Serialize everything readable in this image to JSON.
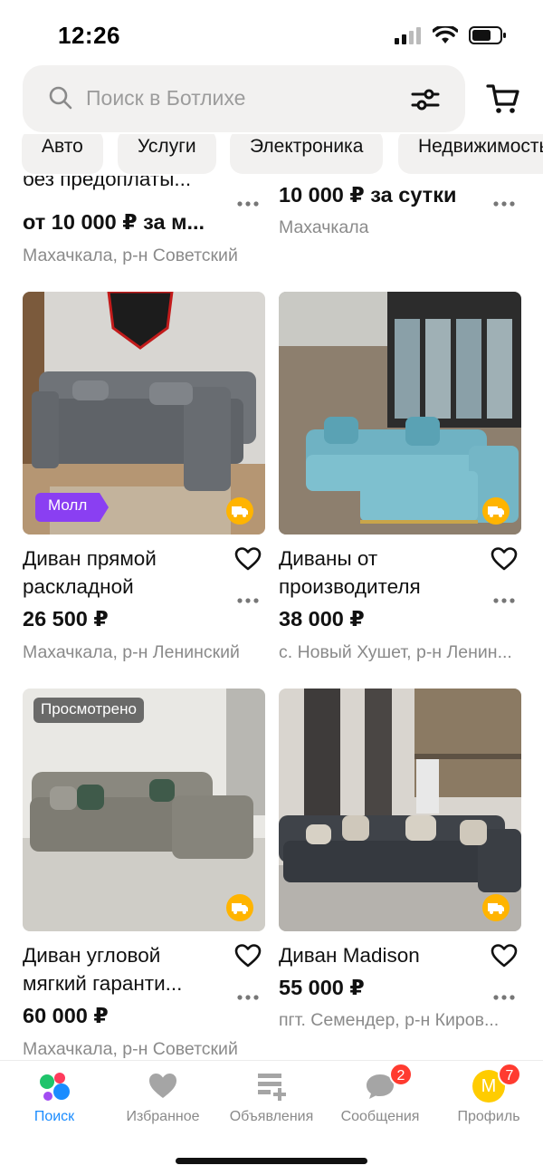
{
  "status": {
    "time": "12:26"
  },
  "search": {
    "placeholder": "Поиск в Ботлихе"
  },
  "categories": [
    "Авто",
    "Услуги",
    "Электроника",
    "Недвижимость"
  ],
  "partial_cards": [
    {
      "title_tail": "без предоплаты...",
      "price": "от 10 000 ₽ за м...",
      "location": "Махачкала, р-н Советский"
    },
    {
      "price": "10 000 ₽ за сутки",
      "location": "Махачкала"
    }
  ],
  "cards": [
    {
      "title": "Диван прямой раскладной",
      "price": "26 500 ₽",
      "location": "Махачкала, р-н Ленинский",
      "badge": "Молл",
      "favorite": false,
      "photo_color": "#7a7f85"
    },
    {
      "title": "Диваны от производителя",
      "price": "38 000 ₽",
      "location": "с. Новый Хушет, р-н Ленин...",
      "badge": "",
      "favorite": false,
      "photo_color": "#7fb8c6"
    },
    {
      "title": "Диван угловой мягкий гаранти...",
      "price": "60 000 ₽",
      "location": "Махачкала, р-н Советский",
      "badge": "Просмотрено",
      "favorite": false,
      "photo_color": "#8b8a83"
    },
    {
      "title": "Диван Madison",
      "price": "55 000 ₽",
      "location": "пгт. Семендер, р-н Киров...",
      "badge": "",
      "favorite": false,
      "photo_color": "#4a4e54"
    }
  ],
  "tabs": [
    {
      "label": "Поиск",
      "icon": "search-dots-icon",
      "active": true,
      "badge": ""
    },
    {
      "label": "Избранное",
      "icon": "heart-icon",
      "active": false,
      "badge": ""
    },
    {
      "label": "Объявления",
      "icon": "listing-add-icon",
      "active": false,
      "badge": ""
    },
    {
      "label": "Сообщения",
      "icon": "chat-icon",
      "active": false,
      "badge": "2"
    },
    {
      "label": "Профиль",
      "icon": "avatar-icon",
      "active": false,
      "badge": "7",
      "avatar_letter": "M"
    }
  ],
  "colors": {
    "accent": "#1a8cff",
    "badge_red": "#ff3b30",
    "delivery": "#ffb400",
    "moll": "#8a3ff2"
  }
}
